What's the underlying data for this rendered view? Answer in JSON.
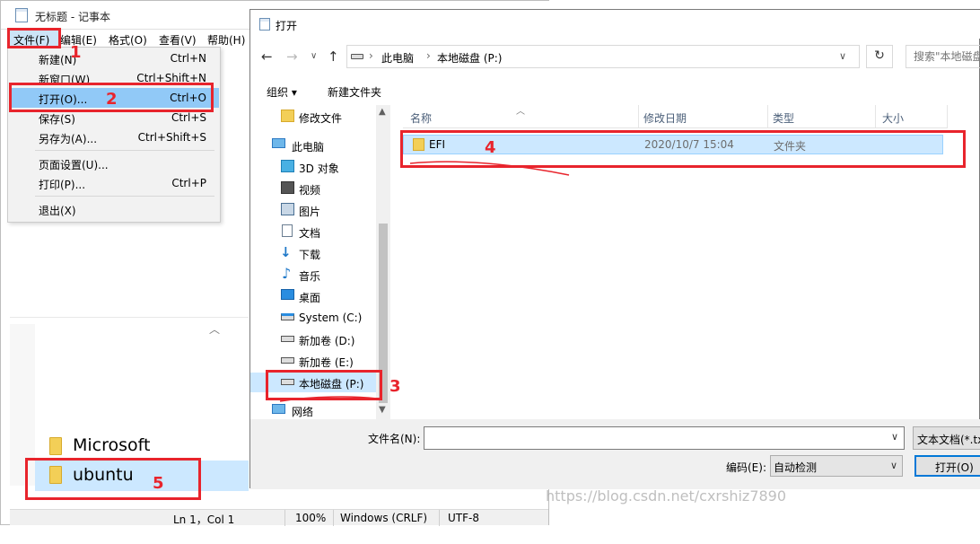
{
  "notepad": {
    "title": "无标题 - 记事本",
    "menu": {
      "file": "文件(F)",
      "edit": "编辑(E)",
      "format": "格式(O)",
      "view": "查看(V)",
      "help": "帮助(H)"
    },
    "file_menu": {
      "new": "新建(N)",
      "new_sc": "Ctrl+N",
      "new_window": "新窗口(W)",
      "new_window_sc": "Ctrl+Shift+N",
      "open": "打开(O)...",
      "open_sc": "Ctrl+O",
      "save": "保存(S)",
      "save_sc": "Ctrl+S",
      "save_as": "另存为(A)...",
      "save_as_sc": "Ctrl+Shift+S",
      "page_setup": "页面设置(U)...",
      "print": "打印(P)...",
      "print_sc": "Ctrl+P",
      "exit": "退出(X)"
    },
    "folders": [
      "Microsoft",
      "ubuntu"
    ],
    "status": {
      "position": "Ln 1，Col 1",
      "zoom": "100%",
      "line_ending": "Windows (CRLF)",
      "encoding": "UTF-8"
    }
  },
  "dialog": {
    "title": "打开",
    "breadcrumb": [
      "此电脑",
      "本地磁盘 (P:)"
    ],
    "search_placeholder": "搜索\"本地磁盘",
    "toolbar": {
      "organize": "组织 ▾",
      "new_folder": "新建文件夹"
    },
    "tree": [
      {
        "label": "修改文件",
        "icon": "folder-icon"
      },
      {
        "label": "此电脑",
        "icon": "computer-icon"
      },
      {
        "label": "3D 对象",
        "icon": "cube-icon"
      },
      {
        "label": "视频",
        "icon": "video-icon"
      },
      {
        "label": "图片",
        "icon": "picture-icon"
      },
      {
        "label": "文档",
        "icon": "document-icon"
      },
      {
        "label": "下载",
        "icon": "download-icon"
      },
      {
        "label": "音乐",
        "icon": "music-icon"
      },
      {
        "label": "桌面",
        "icon": "desktop-icon"
      },
      {
        "label": "System (C:)",
        "icon": "system-drive-icon"
      },
      {
        "label": "新加卷 (D:)",
        "icon": "drive-icon"
      },
      {
        "label": "新加卷 (E:)",
        "icon": "drive-icon"
      },
      {
        "label": "本地磁盘 (P:)",
        "icon": "drive-icon"
      },
      {
        "label": "网络",
        "icon": "network-icon"
      }
    ],
    "columns": {
      "name": "名称",
      "modified": "修改日期",
      "type": "类型",
      "size": "大小"
    },
    "rows": [
      {
        "name": "EFI",
        "modified": "2020/10/7 15:04",
        "type": "文件夹"
      }
    ],
    "filename_label": "文件名(N):",
    "filename_value": "",
    "filetype": "文本文档(*.txt)",
    "encoding_label": "编码(E):",
    "encoding_value": "自动检测",
    "open_button": "打开(O)"
  },
  "annotations": {
    "n1": "1",
    "n2": "2",
    "n3": "3",
    "n4": "4",
    "n5": "5",
    "accent": "#e8242c"
  },
  "watermark": "https://blog.csdn.net/cxrshiz7890"
}
